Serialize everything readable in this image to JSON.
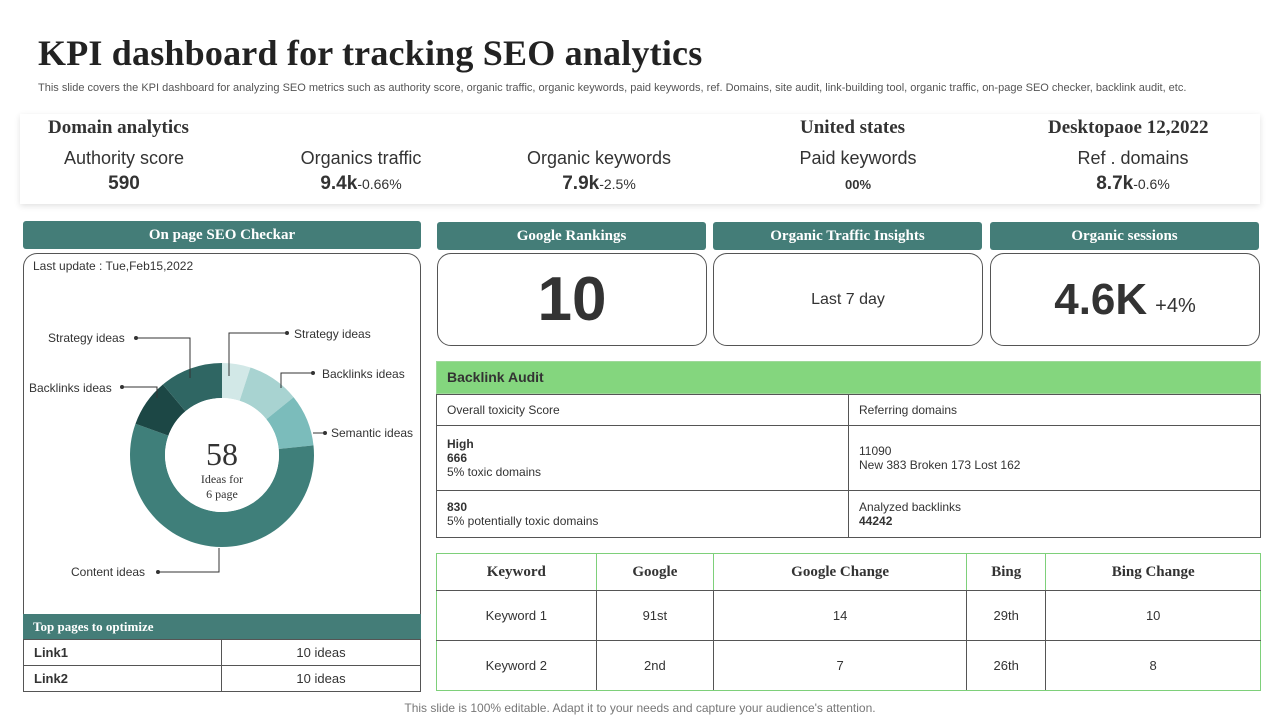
{
  "page": {
    "title": "KPI dashboard for tracking SEO analytics",
    "subtitle": "This slide covers the KPI dashboard for analyzing SEO metrics such as authority score, organic traffic, organic keywords, paid keywords, ref. Domains, site audit, link-building tool, organic traffic, on-page SEO checker, backlink audit, etc.",
    "footer": "This slide is 100% editable. Adapt it to your needs and capture your audience's attention."
  },
  "kpi": {
    "domain_heading": "Domain analytics",
    "region_heading": "United states",
    "date_heading": "Desktopaoe 12,2022",
    "authority": {
      "label": "Authority score",
      "value": "590"
    },
    "organic_traffic": {
      "label": "Organics traffic",
      "value": "9.4k",
      "change": "-0.66%"
    },
    "organic_keywords": {
      "label": "Organic keywords",
      "value": "7.9k",
      "change": "-2.5%"
    },
    "paid_keywords": {
      "label": "Paid keywords",
      "value": "00%"
    },
    "ref_domains": {
      "label": "Ref . domains",
      "value": "8.7k",
      "change": "-0.6%"
    }
  },
  "seo_checker": {
    "header": "On page SEO Checkar",
    "last_update": "Last update : Tue,Feb15,2022",
    "center_number": "58",
    "center_line1": "Ideas for",
    "center_line2": "6 page",
    "labels": {
      "strategy_left": "Strategy ideas",
      "strategy_right": "Strategy ideas",
      "backlinks_left": "Backlinks ideas",
      "backlinks_right": "Backlinks ideas",
      "semantic": "Semantic ideas",
      "content": "Content ideas"
    },
    "colors": {
      "dark_teal": "#1e4d4b",
      "teal": "#2f6663",
      "medium": "#447d78",
      "light1": "#7bbcbb",
      "light2": "#a8d3d1",
      "light3": "#d2e8e7"
    }
  },
  "top_pages": {
    "header": "Top pages to optimize",
    "rows": [
      {
        "link": "Link1",
        "value": "10 ideas"
      },
      {
        "link": "Link2",
        "value": "10 ideas"
      }
    ]
  },
  "google_rankings": {
    "header": "Google Rankings",
    "value": "10"
  },
  "organic_traffic_insights": {
    "header": "Organic Traffic Insights",
    "text": "Last 7 day"
  },
  "organic_sessions": {
    "header": "Organic sessions",
    "value": "4.6K",
    "change": "+4%"
  },
  "backlink_audit": {
    "header": "Backlink Audit",
    "toxicity_label": "Overall  toxicity Score",
    "referring_label": "Referring  domains",
    "high_label": "High",
    "high_value": "666",
    "high_note": "5% toxic domains",
    "referring_value": "11090",
    "referring_note": "New 383 Broken 173 Lost 162",
    "potential_value": "830",
    "potential_note": "5% potentially toxic domains",
    "analyzed_label": "Analyzed backlinks",
    "analyzed_value": "44242"
  },
  "keywords": {
    "headers": [
      "Keyword",
      "Google",
      "Google Change",
      "Bing",
      "Bing Change"
    ],
    "rows": [
      [
        "Keyword  1",
        "91st",
        "14",
        "29th",
        "10"
      ],
      [
        "Keyword  2",
        "2nd",
        "7",
        "26th",
        "8"
      ]
    ]
  }
}
